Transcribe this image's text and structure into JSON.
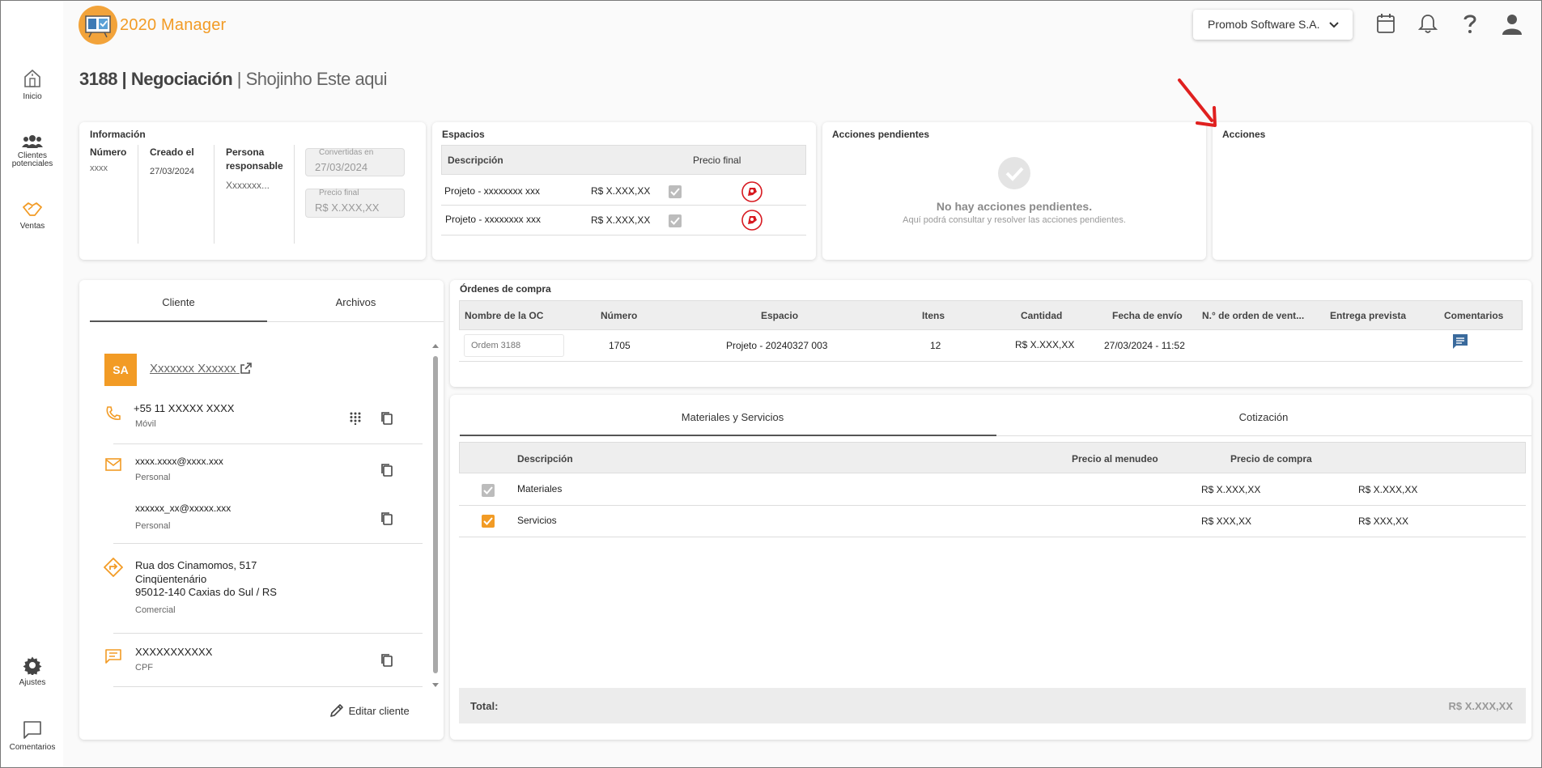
{
  "app": {
    "logo_text": "2020 Manager"
  },
  "sidebar": {
    "items": [
      {
        "label": "Inicio",
        "icon": "home-icon"
      },
      {
        "label": "Clientes potenciales",
        "icon": "users-icon"
      },
      {
        "label": "Ventas",
        "icon": "handshake-icon"
      },
      {
        "label": "Ajustes",
        "icon": "gear-icon"
      },
      {
        "label": "Comentarios",
        "icon": "comment-icon"
      }
    ]
  },
  "header": {
    "company": "Promob Software S.A.",
    "icons": [
      "calendar-icon",
      "bell-icon",
      "help-icon",
      "user-icon"
    ]
  },
  "page": {
    "title_id": "3188 | Negociación",
    "title_sub": " | Shojinho Este aqui"
  },
  "info": {
    "title": "Información",
    "numero_label": "Número",
    "numero_value": "xxxx",
    "creado_label": "Creado el",
    "creado_value": "27/03/2024",
    "persona_label": "Persona responsable",
    "persona_value": "Xxxxxxx...",
    "convertidas_label": "Convertidas en",
    "convertidas_value": "27/03/2024",
    "precio_label": "Precio final",
    "precio_value": "R$ X.XXX,XX"
  },
  "espacios": {
    "title": "Espacios",
    "headers": [
      "Descripción",
      "Precio final"
    ],
    "rows": [
      {
        "desc": "Projeto - xxxxxxxx xxx",
        "price": "R$ X.XXX,XX"
      },
      {
        "desc": "Projeto - xxxxxxxx xxx",
        "price": "R$ X.XXX,XX"
      }
    ]
  },
  "pendientes": {
    "title": "Acciones pendientes",
    "empty_title": "No hay acciones pendientes.",
    "empty_sub": "Aquí podrá consultar y resolver las acciones pendientes."
  },
  "acciones": {
    "title": "Acciones"
  },
  "cliente": {
    "tabs": [
      "Cliente",
      "Archivos"
    ],
    "initials": "SA",
    "name": "Xxxxxxx Xxxxxx",
    "phone": "+55 11 XXXXX XXXX",
    "phone_type": "Móvil",
    "email1": "xxxx.xxxx@xxxx.xxx",
    "email1_type": "Personal",
    "email2": "xxxxxx_xx@xxxxx.xxx",
    "email2_type": "Personal",
    "address_line1": "Rua dos Cinamomos, 517",
    "address_line2": "Cinqüentenário",
    "address_line3": "95012-140 Caxias do Sul / RS",
    "address_type": "Comercial",
    "doc": "XXXXXXXXXXX",
    "doc_type": "CPF",
    "edit_label": "Editar cliente"
  },
  "ordenes": {
    "title": "Órdenes de compra",
    "headers": [
      "Nombre de la OC",
      "Número",
      "Espacio",
      "Itens",
      "Cantidad",
      "Fecha de envío",
      "N.° de orden de vent...",
      "Entrega prevista",
      "Comentarios"
    ],
    "row": {
      "nombre_placeholder": "Ordem 3188",
      "numero": "1705",
      "espacio": "Projeto - 20240327 003",
      "itens": "12",
      "cantidad": "R$ X.XXX,XX",
      "fecha": "27/03/2024 - 11:52"
    }
  },
  "materiales": {
    "tabs": [
      "Materiales y Servicios",
      "Cotización"
    ],
    "headers": [
      "Descripción",
      "Precio al menudeo",
      "Precio de compra"
    ],
    "rows": [
      {
        "desc": "Materiales",
        "menudeo": "R$ X.XXX,XX",
        "compra": "R$ X.XXX,XX"
      },
      {
        "desc": "Servicios",
        "menudeo": "R$ XXX,XX",
        "compra": "R$ XXX,XX"
      }
    ],
    "total_label": "Total:",
    "total_value": "R$ X.XXX,XX"
  }
}
